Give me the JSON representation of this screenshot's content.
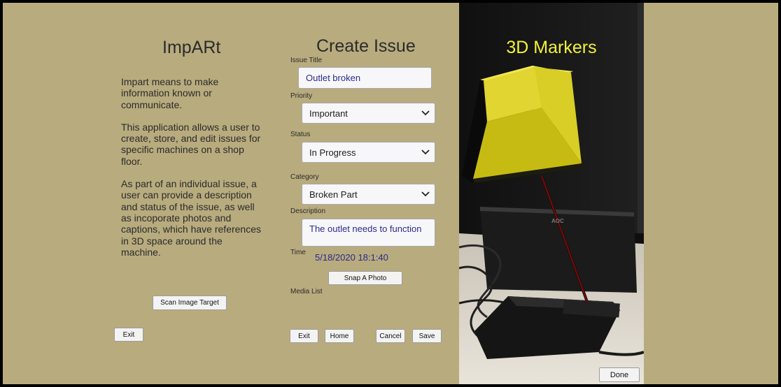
{
  "intro": {
    "title": "ImpARt",
    "paragraphs": [
      "Impart means to make information known or communicate.",
      "This application allows a user to create, store, and edit issues for specific machines on a shop floor.",
      "As part of an individual issue, a user can provide a description and status of the issue, as well as incoporate photos and captions, which have references in 3D space around the machine."
    ],
    "scan_label": "Scan Image Target",
    "exit_label": "Exit"
  },
  "create": {
    "title": "Create Issue",
    "issue_title_label": "Issue Title",
    "issue_title_value": "Outlet broken",
    "priority_label": "Priority",
    "priority_value": "Important",
    "status_label": "Status",
    "status_value": "In Progress",
    "category_label": "Category",
    "category_value": "Broken Part",
    "description_label": "Description",
    "description_value": "The outlet needs to function",
    "time_label": "Time",
    "time_value": "5/18/2020 18:1:40",
    "snap_label": "Snap A Photo",
    "media_label": "Media List",
    "exit_label": "Exit",
    "home_label": "Home",
    "cancel_label": "Cancel",
    "save_label": "Save"
  },
  "markers": {
    "title": "3D Markers",
    "done_label": "Done",
    "monitor_brand": "AOC"
  },
  "colors": {
    "background": "#b8ab7e",
    "marker_yellow": "#d4c81a",
    "title_yellow": "#f2f23a",
    "input_text": "#2a2a8a"
  }
}
